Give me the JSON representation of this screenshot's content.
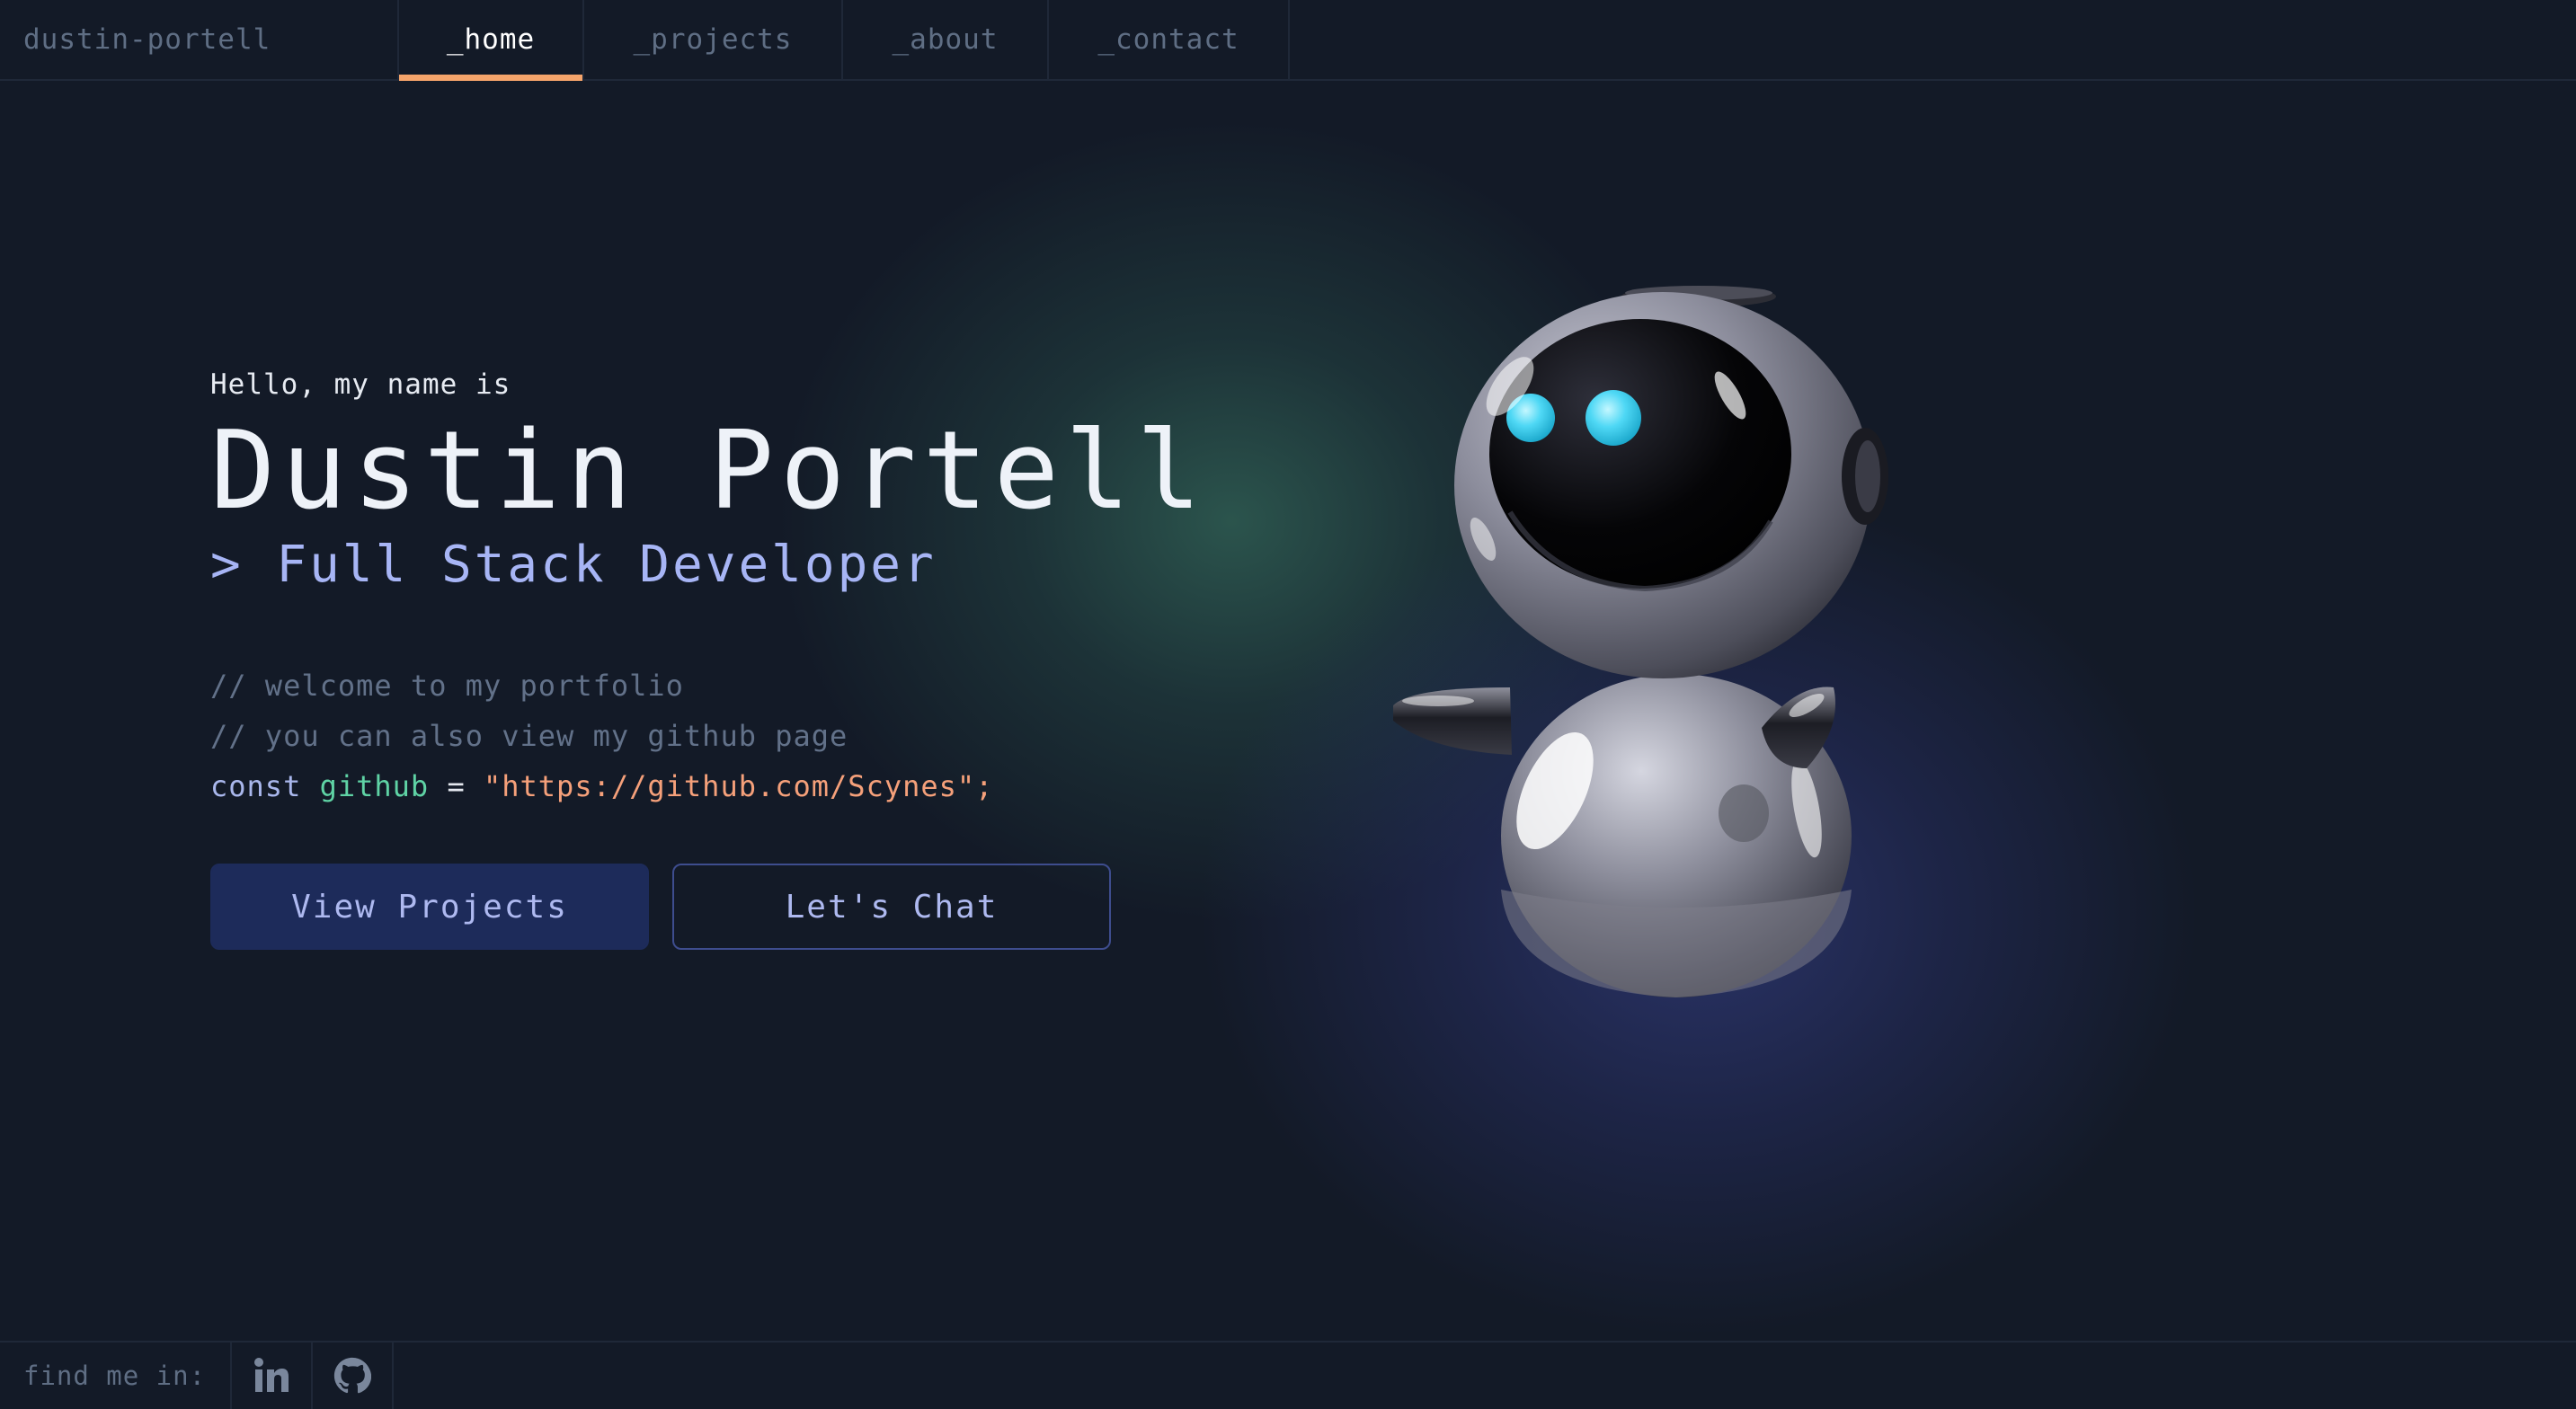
{
  "header": {
    "brand": "dustin-portell",
    "tabs": [
      {
        "label": "_home",
        "active": true
      },
      {
        "label": "_projects",
        "active": false
      },
      {
        "label": "_about",
        "active": false
      },
      {
        "label": "_contact",
        "active": false
      }
    ]
  },
  "hero": {
    "greeting": "Hello, my name is",
    "name": "Dustin Portell",
    "role": "> Full Stack Developer",
    "comments": [
      "// welcome to my portfolio",
      "// you can also view my github page"
    ],
    "code": {
      "keyword": "const",
      "variable": "github",
      "operator": "=",
      "value": "\"https://github.com/Scynes\";"
    },
    "buttons": {
      "primary": "View Projects",
      "secondary": "Let's Chat"
    }
  },
  "footer": {
    "label": "find me in:",
    "social_icons": [
      "linkedin-icon",
      "github-icon"
    ]
  },
  "colors": {
    "background": "#131a27",
    "accent_orange": "#f5a46b",
    "lavender": "#a7b5f5",
    "green": "#5fd3a5",
    "string_orange": "#f5a07a",
    "comment_gray": "#627189",
    "button_primary": "#1d2b5a",
    "button_border": "#3e4d8e",
    "robot_eye": "#4fd8f5"
  }
}
